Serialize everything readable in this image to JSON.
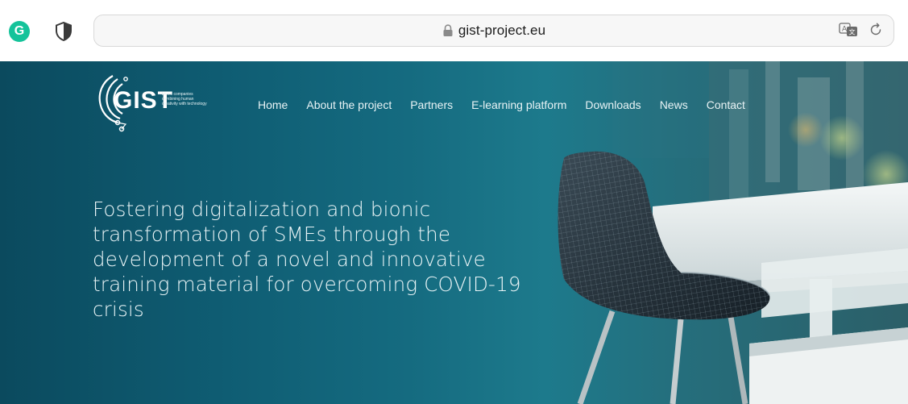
{
  "browser": {
    "url": "gist-project.eu",
    "grammarly_letter": "G",
    "icons": [
      "grammarly-icon",
      "shield-icon",
      "lock-icon",
      "translate-icon",
      "reload-icon"
    ]
  },
  "site": {
    "logo": {
      "word": "GIST",
      "tagline": [
        "bionic companies",
        "combining human",
        "creativity with technology"
      ]
    },
    "nav": [
      "Home",
      "About the project",
      "Partners",
      "E-learning platform",
      "Downloads",
      "News",
      "Contact"
    ],
    "headline": "Fostering digitalization and bionic transformation of SMEs through the development of a novel and innovative training material for overcoming COVID-19 crisis"
  },
  "colors": {
    "hero_teal": "#156b80",
    "grammarly_green": "#15c39a",
    "text_light": "#e9f4f6"
  }
}
